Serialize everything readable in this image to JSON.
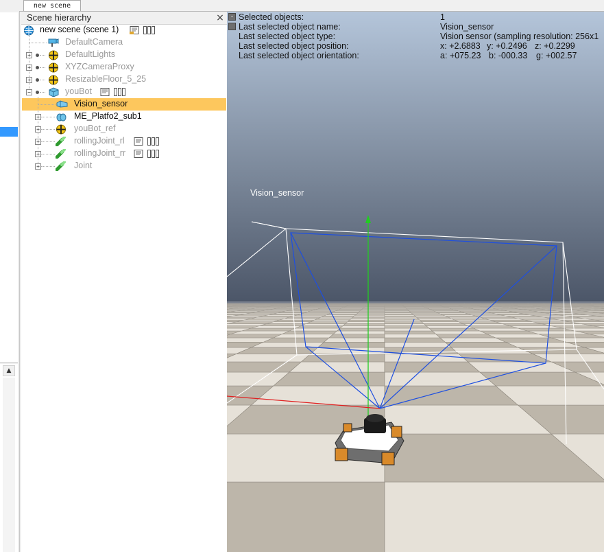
{
  "tab": {
    "label": "new scene"
  },
  "hierarchy": {
    "title": "Scene hierarchy",
    "close_glyph": "×",
    "rows": [
      {
        "label": "new scene (scene 1)"
      },
      {
        "label": "DefaultCamera"
      },
      {
        "label": "DefaultLights"
      },
      {
        "label": "XYZCameraProxy"
      },
      {
        "label": "ResizableFloor_5_25"
      },
      {
        "label": "youBot"
      },
      {
        "label": "Vision_sensor"
      },
      {
        "label": "ME_Platfo2_sub1"
      },
      {
        "label": "youBot_ref"
      },
      {
        "label": "rollingJoint_rl"
      },
      {
        "label": "rollingJoint_rr"
      },
      {
        "label": "Joint"
      }
    ]
  },
  "info": {
    "selected_objects_label": "Selected objects:",
    "selected_objects_value": "1",
    "name_label": "Last selected object name:",
    "name_value": "Vision_sensor",
    "type_label": "Last selected object type:",
    "type_value": "Vision sensor (sampling resolution: 256x1",
    "position_label": "Last selected object position:",
    "position_x": "x: +2.6883",
    "position_y": "y: +0.2496",
    "position_z": "z: +0.2299",
    "orientation_label": "Last selected object orientation:",
    "orientation_a": "a: +075.23",
    "orientation_b": "b: -000.33",
    "orientation_g": "g: +002.57"
  },
  "scene_label": "Vision_sensor",
  "colors": {
    "selection": "#fdc75d",
    "frustum_blue": "#1e4fe0",
    "axis_green": "#22cc22",
    "axis_red": "#e02020",
    "sky_top": "#aebfd6",
    "sky_bottom": "#4e596b"
  }
}
